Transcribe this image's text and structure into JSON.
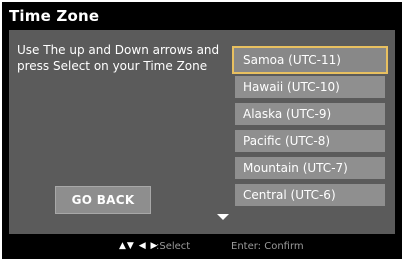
{
  "screen": {
    "title": "Time Zone",
    "instruction": "Use The up and Down arrows and press Select on your Time Zone",
    "go_back_label": "GO BACK"
  },
  "time_zones": [
    {
      "label": "Samoa (UTC-11)",
      "selected": true
    },
    {
      "label": "Hawaii (UTC-10)",
      "selected": false
    },
    {
      "label": "Alaska (UTC-9)",
      "selected": false
    },
    {
      "label": "Pacific (UTC-8)",
      "selected": false
    },
    {
      "label": "Mountain (UTC-7)",
      "selected": false
    },
    {
      "label": "Central (UTC-6)",
      "selected": false
    }
  ],
  "footer": {
    "nav_icons": "▲▼ ◀ ▶",
    "select_label": ":Select",
    "confirm_label": "Enter: Confirm"
  },
  "colors": {
    "background": "#000000",
    "panel": "#5b5b5b",
    "item": "#8f8f8f",
    "highlight_border": "#e8c060"
  }
}
